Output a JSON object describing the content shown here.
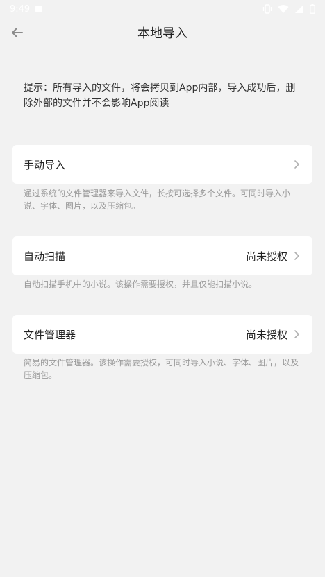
{
  "statusbar": {
    "time": "9:49"
  },
  "header": {
    "title": "本地导入"
  },
  "hint": {
    "text": "提示：所有导入的文件，将会拷贝到App内部，导入成功后，删除外部的文件并不会影响App阅读"
  },
  "options": [
    {
      "label": "手动导入",
      "status": "",
      "description": "通过系统的文件管理器来导入文件，长按可选择多个文件。可同时导入小说、字体、图片，以及压缩包。"
    },
    {
      "label": "自动扫描",
      "status": "尚未授权",
      "description": "自动扫描手机中的小说。该操作需要授权，并且仅能扫描小说。"
    },
    {
      "label": "文件管理器",
      "status": "尚未授权",
      "description": "简易的文件管理器。该操作需要授权，可同时导入小说、字体、图片，以及压缩包。"
    }
  ],
  "icons": {
    "back": "back-arrow-icon",
    "chevron": "chevron-right-icon"
  },
  "colors": {
    "background": "#f2f2f2",
    "card": "#ffffff",
    "secondary_text": "#9a9a9a"
  }
}
